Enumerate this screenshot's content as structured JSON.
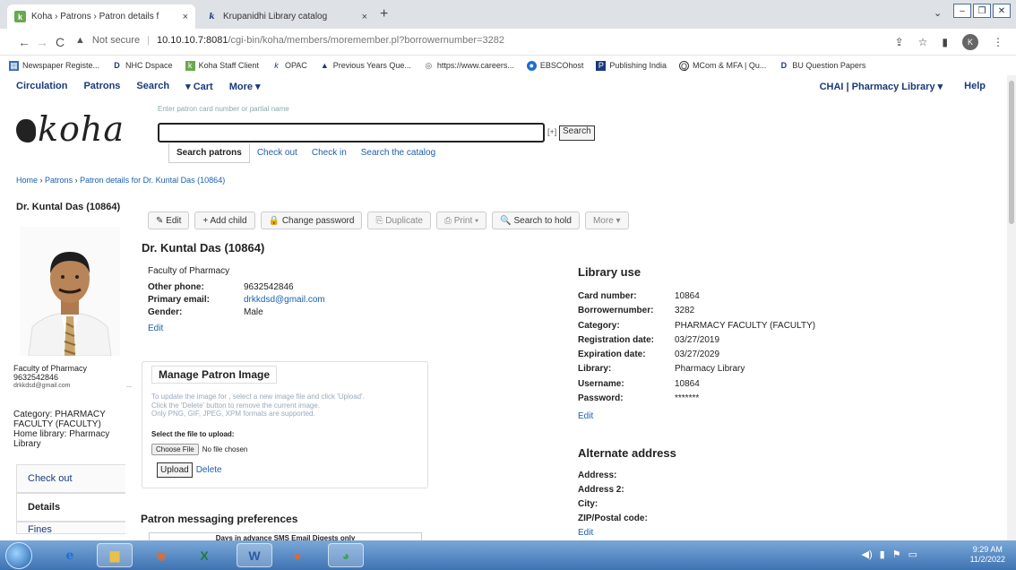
{
  "browser": {
    "tabs": [
      {
        "title": "Koha › Patrons › Patron details f",
        "close": "×"
      },
      {
        "title": "Krupanidhi Library catalog",
        "close": "×"
      }
    ],
    "new_tab": "+",
    "url": {
      "security": "Not secure",
      "host": "10.10.10.7:8081",
      "path": "/cgi-bin/koha/members/moremember.pl?borrowernumber=3282"
    },
    "bookmarks": [
      {
        "label": "Newspaper Registe...",
        "icon": "grid-icon"
      },
      {
        "label": "NHC Dspace",
        "icon": "d-icon"
      },
      {
        "label": "Koha Staff Client",
        "icon": "koha-icon"
      },
      {
        "label": "OPAC",
        "icon": "k-icon"
      },
      {
        "label": "Previous Years Que...",
        "icon": "triangle-icon"
      },
      {
        "label": "https://www.careers...",
        "icon": "globe-icon"
      },
      {
        "label": "EBSCOhost",
        "icon": "circle-icon"
      },
      {
        "label": "Publishing India",
        "icon": "p-icon"
      },
      {
        "label": "MCom & MFA | Qu...",
        "icon": "q-icon"
      },
      {
        "label": "BU Question Papers",
        "icon": "d-icon"
      }
    ],
    "profile_initial": "K"
  },
  "koha_nav": {
    "left": [
      "Circulation",
      "Patrons",
      "Search",
      "▾ Cart",
      "More ▾"
    ],
    "library": "CHAI | Pharmacy Library ▾",
    "help": "Help"
  },
  "logo_text": "koha",
  "search": {
    "hint": "Enter patron card number or partial name",
    "plus": "[+]",
    "button": "Search",
    "tabs": [
      "Search patrons",
      "Check out",
      "Check in",
      "Search the catalog"
    ]
  },
  "breadcrumb": {
    "home": "Home",
    "patrons": "Patrons",
    "current": "Patron details for Dr. Kuntal Das (10864)",
    "sep": "›"
  },
  "sidebar": {
    "patron_name": "Dr. Kuntal Das (10864)",
    "faculty": "Faculty of Pharmacy",
    "phone": "9632542846",
    "email": "drkkdsd@gmail.com",
    "dots": "...",
    "category": "Category: PHARMACY FACULTY (FACULTY)",
    "home_library": "Home library: Pharmacy Library",
    "menu": [
      "Check out",
      "Details",
      "Fines"
    ]
  },
  "toolbar": {
    "edit": "✎ Edit",
    "add_child": "+ Add child",
    "change_password": "🔒 Change password",
    "duplicate": "⎘ Duplicate",
    "print": "⎙ Print ▾",
    "search_to_hold": "🔍 Search to hold",
    "more": "More ▾"
  },
  "patron": {
    "title": "Dr. Kuntal Das (10864)",
    "faculty": "Faculty of Pharmacy",
    "other_phone_label": "Other phone:",
    "other_phone": "9632542846",
    "primary_email_label": "Primary email:",
    "primary_email": "drkkdsd@gmail.com",
    "gender_label": "Gender:",
    "gender": "Male",
    "edit": "Edit"
  },
  "manage_image": {
    "title": "Manage Patron Image",
    "hint1": "To update the image for , select a new image file and click 'Upload'.",
    "hint2": "Click the 'Delete' button to remove the current image.",
    "hint3": "Only PNG, GIF, JPEG, XPM formats are supported.",
    "select_label": "Select the file to upload:",
    "choose_file": "Choose File",
    "no_file": "No file chosen",
    "upload": "Upload",
    "delete": "Delete"
  },
  "messaging": {
    "title": "Patron messaging preferences",
    "header": "Days in advance SMS Email Digests only"
  },
  "library_use": {
    "title": "Library use",
    "rows": [
      {
        "label": "Card number:",
        "value": "10864"
      },
      {
        "label": "Borrowernumber:",
        "value": "3282"
      },
      {
        "label": "Category:",
        "value": "PHARMACY FACULTY (FACULTY)"
      },
      {
        "label": "Registration date:",
        "value": "03/27/2019"
      },
      {
        "label": "Expiration date:",
        "value": "03/27/2029"
      },
      {
        "label": "Library:",
        "value": "Pharmacy Library"
      },
      {
        "label": "Username:",
        "value": "10864"
      },
      {
        "label": "Password:",
        "value": "*******"
      }
    ],
    "edit": "Edit"
  },
  "alternate_address": {
    "title": "Alternate address",
    "labels": [
      "Address:",
      "Address 2:",
      "City:",
      "ZIP/Postal code:"
    ],
    "edit": "Edit"
  },
  "taskbar": {
    "time": "9:29 AM",
    "date": "11/2/2022"
  }
}
